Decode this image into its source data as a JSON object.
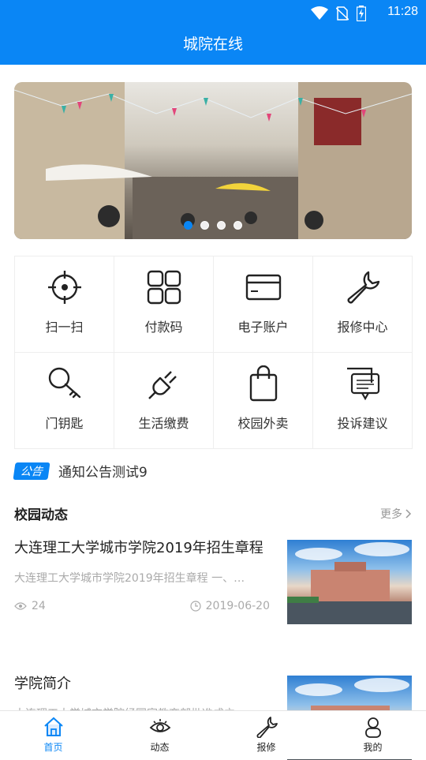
{
  "status_bar": {
    "time": "11:28"
  },
  "header": {
    "title": "城院在线"
  },
  "banner": {
    "slides": 4,
    "active_slide": 0
  },
  "grid": [
    {
      "label": "扫一扫",
      "icon": "scan-icon"
    },
    {
      "label": "付款码",
      "icon": "grid-icon"
    },
    {
      "label": "电子账户",
      "icon": "card-icon"
    },
    {
      "label": "报修中心",
      "icon": "wrench-icon"
    },
    {
      "label": "门钥匙",
      "icon": "key-icon"
    },
    {
      "label": "生活缴费",
      "icon": "plug-icon"
    },
    {
      "label": "校园外卖",
      "icon": "bag-icon"
    },
    {
      "label": "投诉建议",
      "icon": "chat-icon"
    }
  ],
  "notice": {
    "tag": "公告",
    "text": "通知公告测试9"
  },
  "campus": {
    "title": "校园动态",
    "more": "更多",
    "items": [
      {
        "title": "大连理工大学城市学院2019年招生章程",
        "summary": "大连理工大学城市学院2019年招生章程 一、…",
        "views": "24",
        "date": "2019-06-20"
      },
      {
        "title": "学院简介",
        "summary": "大连理工大学城市学院经国家教育部批准成立…"
      }
    ]
  },
  "tabbar": [
    {
      "label": "首页",
      "icon": "home-icon",
      "active": true
    },
    {
      "label": "动态",
      "icon": "eye-icon"
    },
    {
      "label": "报修",
      "icon": "wrench-icon"
    },
    {
      "label": "我的",
      "icon": "person-icon"
    }
  ],
  "colors": {
    "primary": "#0a86f5"
  }
}
